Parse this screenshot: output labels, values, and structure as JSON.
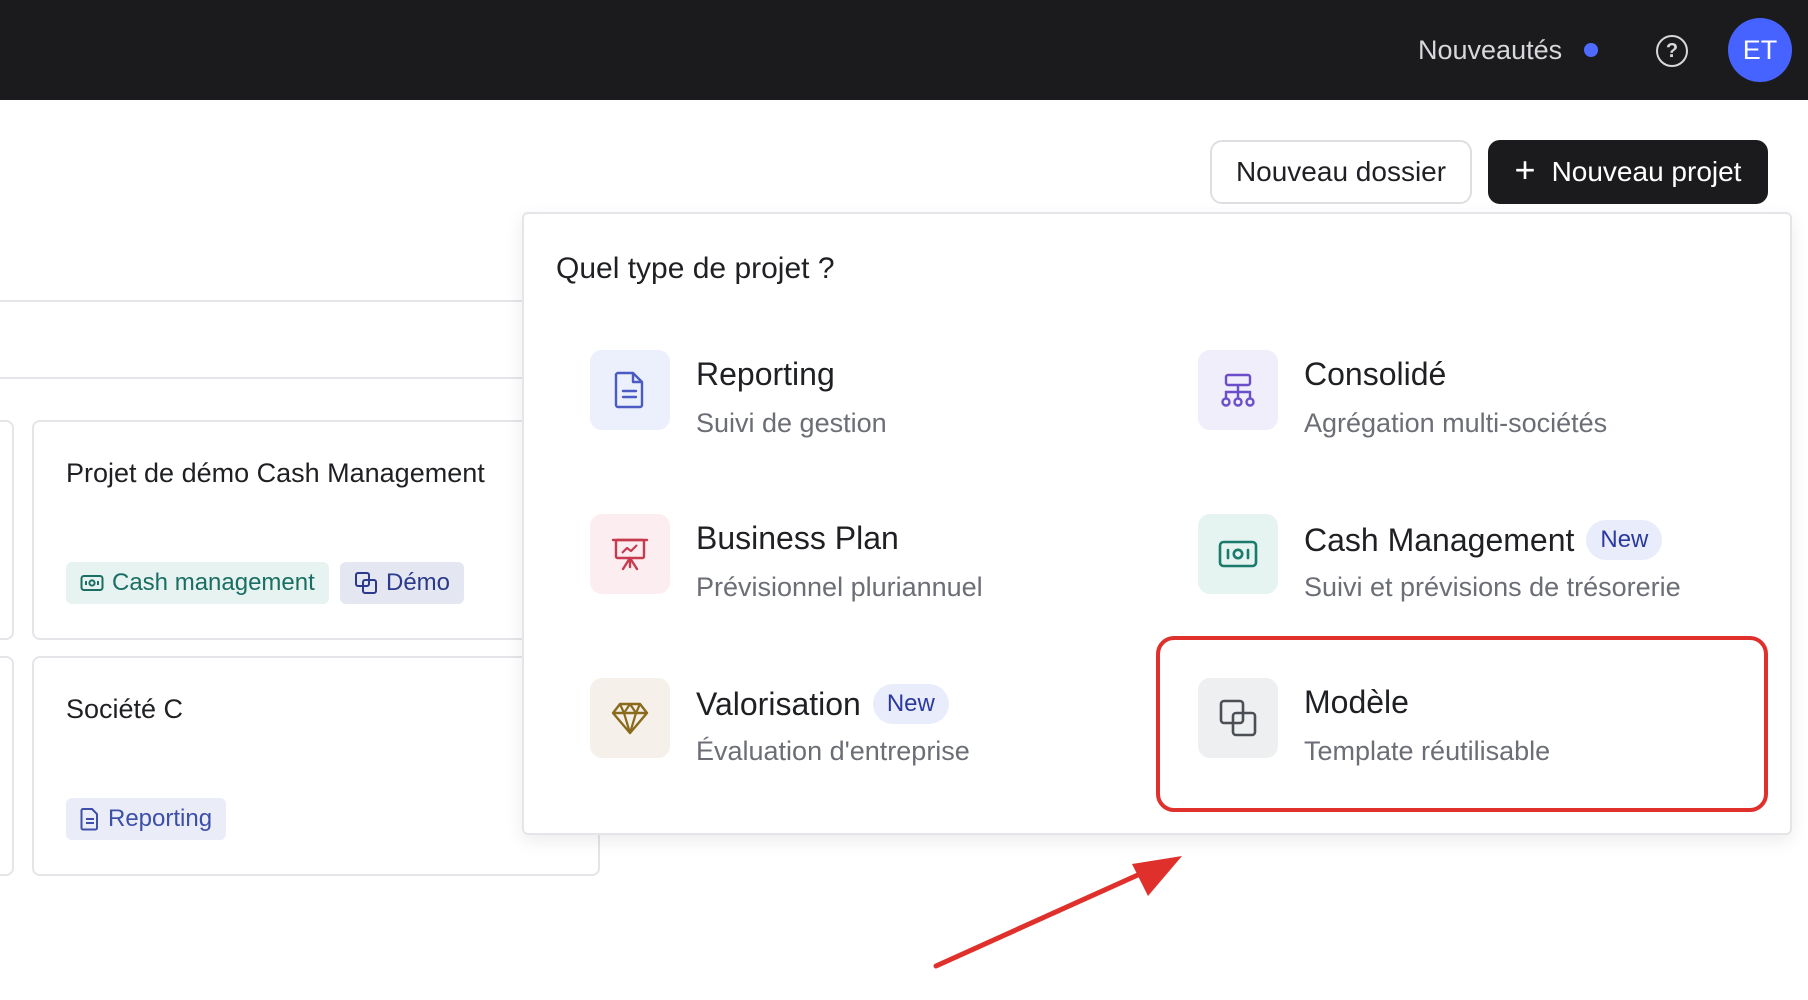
{
  "header": {
    "news_label": "Nouveautés",
    "help_icon": "help-circle-icon",
    "avatar_initials": "ET"
  },
  "toolbar": {
    "new_folder_label": "Nouveau dossier",
    "new_project_label": "Nouveau projet",
    "new_project_icon": "plus-icon"
  },
  "cards": [
    {
      "title": "Projet de démo Cash Management",
      "tags": [
        {
          "label": "Cash management",
          "icon": "cash-icon"
        },
        {
          "label": "Démo",
          "icon": "copy-icon"
        }
      ]
    },
    {
      "title": "Société C",
      "tags": [
        {
          "label": "Reporting",
          "icon": "document-icon"
        }
      ]
    }
  ],
  "popup": {
    "title": "Quel type de projet ?",
    "options": [
      {
        "title": "Reporting",
        "subtitle": "Suivi de gestion",
        "icon": "document-icon",
        "badge": ""
      },
      {
        "title": "Consolidé",
        "subtitle": "Agrégation multi-sociétés",
        "icon": "hierarchy-icon",
        "badge": ""
      },
      {
        "title": "Business Plan",
        "subtitle": "Prévisionnel pluriannuel",
        "icon": "presentation-icon",
        "badge": ""
      },
      {
        "title": "Cash Management",
        "subtitle": "Suivi et prévisions de trésorerie",
        "icon": "cash-icon",
        "badge": "New"
      },
      {
        "title": "Valorisation",
        "subtitle": "Évaluation d'entreprise",
        "icon": "diamond-icon",
        "badge": "New"
      },
      {
        "title": "Modèle",
        "subtitle": "Template réutilisable",
        "icon": "copy-icon",
        "badge": ""
      }
    ]
  },
  "colors": {
    "accent": "#4663ff",
    "highlight": "#e0302b"
  }
}
